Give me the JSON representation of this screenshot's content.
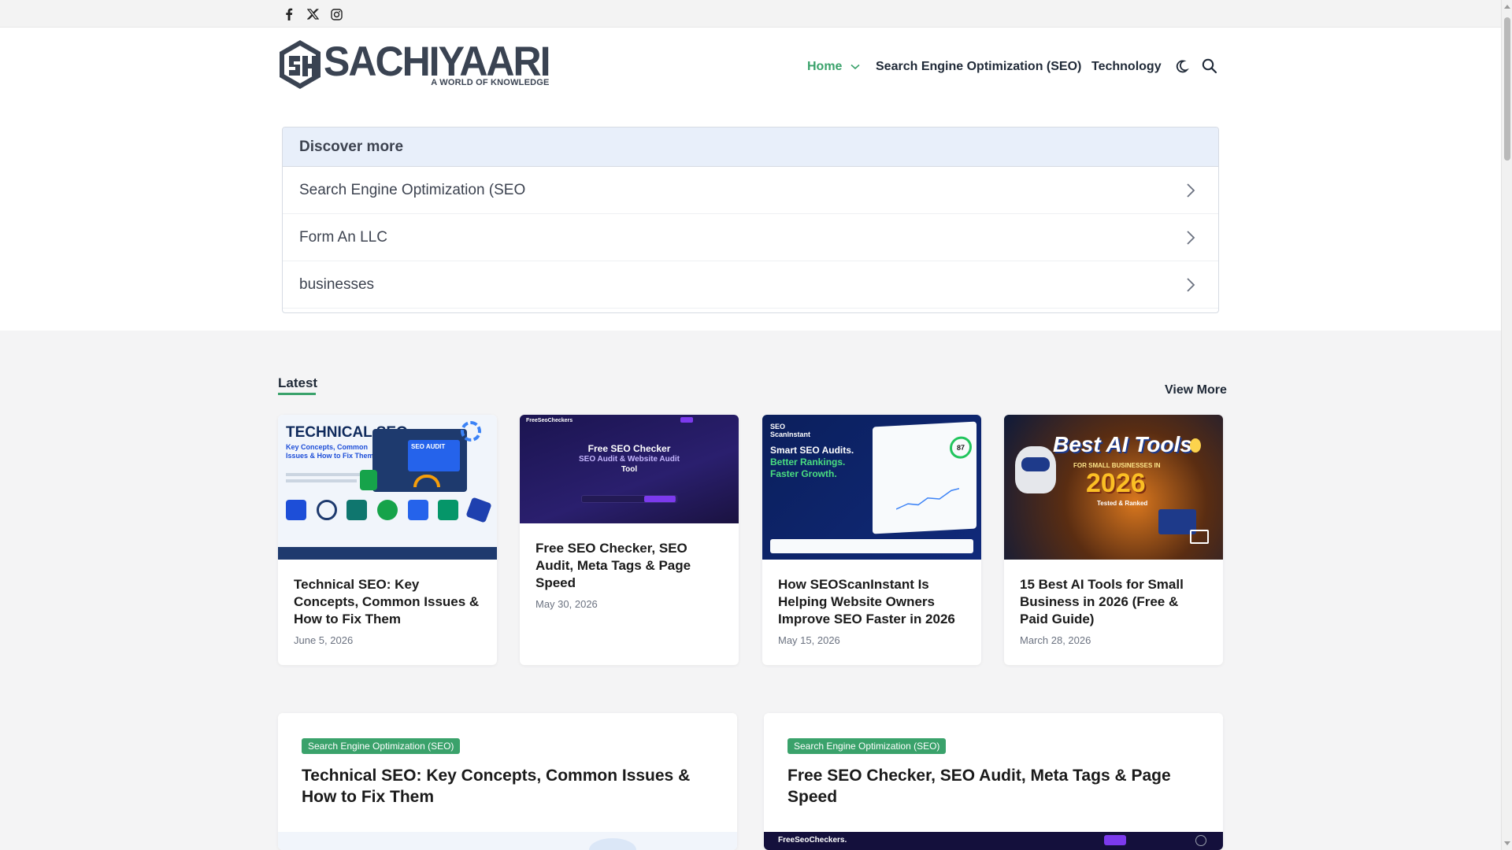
{
  "social": {
    "icons": [
      "facebook-icon",
      "x-icon",
      "instagram-icon"
    ]
  },
  "site": {
    "logo_main": "SACHIYAARI",
    "logo_sub": "A WORLD OF KNOWLEDGE"
  },
  "nav": {
    "home": "Home",
    "seo": "Search Engine Optimization (SEO)",
    "technology": "Technology",
    "active_color": "#3aa26b"
  },
  "discover": {
    "title": "Discover more",
    "items": [
      {
        "label": "Search Engine Optimization (SEO"
      },
      {
        "label": "Form An LLC"
      },
      {
        "label": "businesses"
      }
    ]
  },
  "latest": {
    "label": "Latest",
    "view_more": "View More",
    "cards": [
      {
        "title": "Technical SEO: Key Concepts, Common Issues & How to Fix Them",
        "date": "June 5, 2026",
        "thumb": {
          "heading": "TECHNICAL SEO",
          "sub": "Key Concepts, Common Issues & How to Fix Them",
          "badge": "SEO AUDIT"
        }
      },
      {
        "title": "Free SEO Checker, SEO Audit, Meta Tags & Page Speed",
        "date": "May 30, 2026",
        "thumb": {
          "brand": "FreeSeoCheckers",
          "heading": "Free SEO Checker",
          "sub": "SEO Audit & Website Audit",
          "tail": "Tool"
        }
      },
      {
        "title": "How SEOScanInstant Is Helping Website Owners Improve SEO Faster in 2026",
        "date": "May 15, 2026",
        "thumb": {
          "brand": "SEO ScanInstant",
          "line1": "Smart SEO Audits.",
          "line2": "Better Rankings.",
          "line3": "Faster Growth.",
          "score": "87"
        }
      },
      {
        "title": "15 Best AI Tools for Small Business in 2026 (Free & Paid Guide)",
        "date": "March 28, 2026",
        "thumb": {
          "heading": "Best AI Tools",
          "sub": "FOR SMALL BUSINESSES IN",
          "year": "2026",
          "tag": "Tested & Ranked"
        }
      }
    ]
  },
  "featured": [
    {
      "category": "Search Engine Optimization (SEO)",
      "title": "Technical SEO: Key Concepts, Common Issues & How to Fix Them"
    },
    {
      "category": "Search Engine Optimization (SEO)",
      "title": "Free SEO Checker, SEO Audit, Meta Tags & Page Speed",
      "thumb_brand": "FreeSeoCheckers."
    }
  ]
}
